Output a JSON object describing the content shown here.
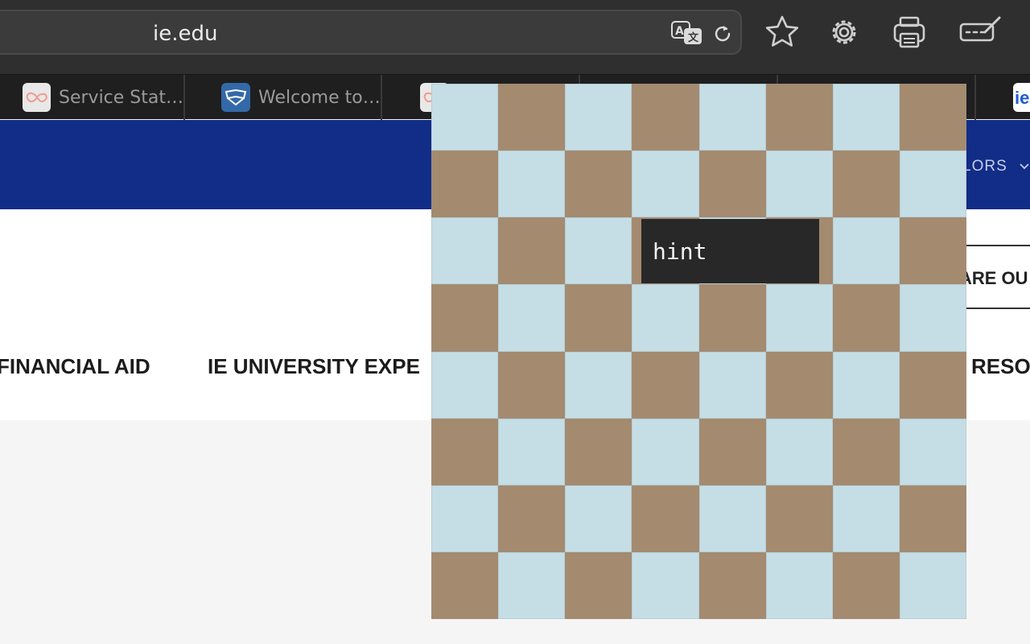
{
  "browser": {
    "url": "ie.edu",
    "icons": [
      "translate-icon",
      "reload-icon",
      "bookmark-star-icon",
      "settings-gear-icon",
      "print-icon",
      "edit-icon"
    ],
    "tabs": [
      {
        "label": "Service Stat…",
        "favicon": "infinity-icon",
        "favicon_color": "#e8e8e8",
        "glyph_color": "#f09a8c"
      },
      {
        "label": "Welcome to…",
        "favicon": "flag-icon",
        "favicon_color": "#3369a8",
        "glyph_color": "#ffffff"
      },
      {
        "label": "",
        "favicon": "infinity-icon",
        "favicon_color": "#e8e8e8",
        "glyph_color": "#f09a8c"
      },
      {
        "label": "",
        "favicon": "blank-icon",
        "favicon_color": "#e8e8e8",
        "glyph_color": "#ffffff"
      },
      {
        "label": "",
        "favicon": "blank-icon",
        "favicon_color": "#1f1f1f",
        "glyph_color": "#ffffff"
      },
      {
        "label": "",
        "favicon": "ie-logo-icon",
        "favicon_color": "#ffffff",
        "glyph_color": "#1f5bd6"
      }
    ]
  },
  "site": {
    "header_color": "#122d87",
    "nav_partial": "LORS",
    "compare_partial": "ARE OU",
    "menu": {
      "financial_aid": "FINANCIAL AID",
      "experience": "IE UNIVERSITY EXPE",
      "resources": "RESO"
    }
  },
  "game": {
    "board_size": 8,
    "light_color": "#c5dee5",
    "dark_color": "#a48a6e",
    "hint_label": "hint"
  }
}
